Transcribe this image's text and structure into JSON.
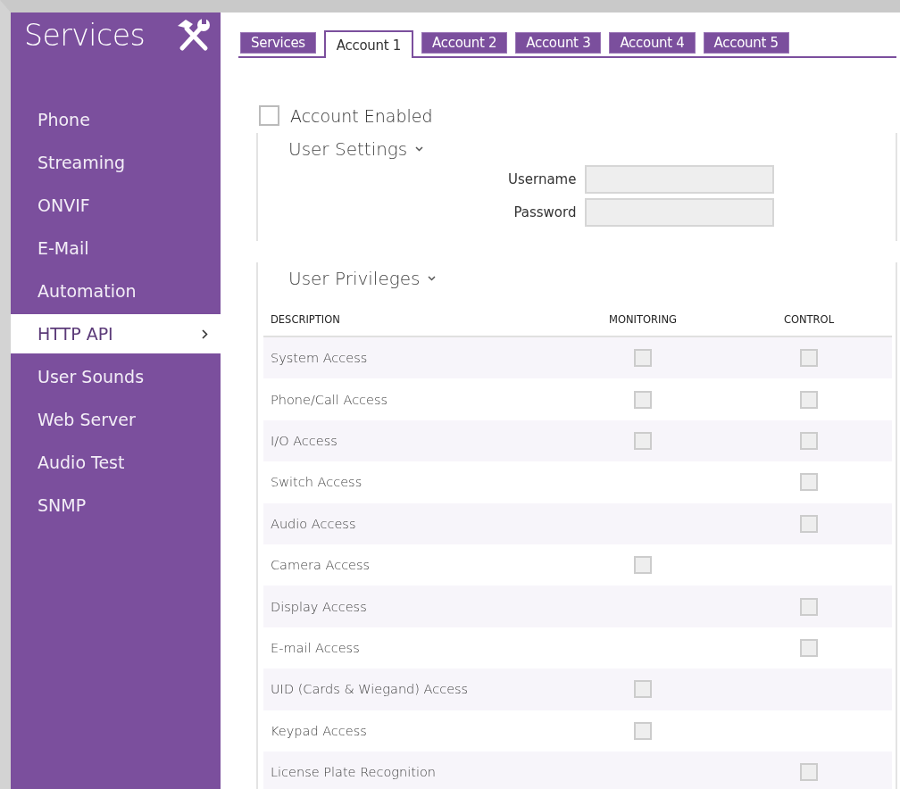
{
  "sidebar": {
    "title": "Services",
    "items": [
      {
        "label": "Phone",
        "selected": false
      },
      {
        "label": "Streaming",
        "selected": false
      },
      {
        "label": "ONVIF",
        "selected": false
      },
      {
        "label": "E-Mail",
        "selected": false
      },
      {
        "label": "Automation",
        "selected": false
      },
      {
        "label": "HTTP API",
        "selected": true
      },
      {
        "label": "User Sounds",
        "selected": false
      },
      {
        "label": "Web Server",
        "selected": false
      },
      {
        "label": "Audio Test",
        "selected": false
      },
      {
        "label": "SNMP",
        "selected": false
      }
    ]
  },
  "tabs": [
    {
      "label": "Services",
      "selected": false
    },
    {
      "label": "Account 1",
      "selected": true
    },
    {
      "label": "Account 2",
      "selected": false
    },
    {
      "label": "Account 3",
      "selected": false
    },
    {
      "label": "Account 4",
      "selected": false
    },
    {
      "label": "Account 5",
      "selected": false
    }
  ],
  "account_enabled": {
    "label": "Account Enabled",
    "checked": false
  },
  "user_settings": {
    "title": "User Settings",
    "fields": [
      {
        "label": "Username"
      },
      {
        "label": "Password"
      }
    ]
  },
  "user_privileges": {
    "title": "User Privileges",
    "columns": [
      "DESCRIPTION",
      "MONITORING",
      "CONTROL"
    ],
    "rows": [
      {
        "description": "System Access",
        "monitoring": {
          "checked": false
        },
        "control": {
          "checked": false
        }
      },
      {
        "description": "Phone/Call Access",
        "monitoring": {
          "checked": false
        },
        "control": {
          "checked": false
        }
      },
      {
        "description": "I/O Access",
        "monitoring": {
          "checked": false
        },
        "control": {
          "checked": false
        }
      },
      {
        "description": "Switch Access",
        "control": {
          "checked": false
        }
      },
      {
        "description": "Audio Access",
        "control": {
          "checked": false
        }
      },
      {
        "description": "Camera Access",
        "monitoring": {
          "checked": false
        }
      },
      {
        "description": "Display Access",
        "control": {
          "checked": false
        }
      },
      {
        "description": "E-mail Access",
        "control": {
          "checked": false
        }
      },
      {
        "description": "UID (Cards & Wiegand) Access",
        "monitoring": {
          "checked": false
        }
      },
      {
        "description": "Keypad Access",
        "monitoring": {
          "checked": false
        }
      },
      {
        "description": "License Plate Recognition",
        "control": {
          "checked": false
        }
      }
    ]
  }
}
